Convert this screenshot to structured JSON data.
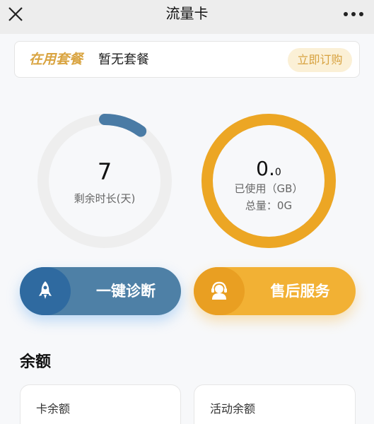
{
  "header": {
    "title": "流量卡",
    "close_icon": "close-icon",
    "more_icon": "more-dots-icon"
  },
  "package": {
    "label": "在用套餐",
    "value": "暂无套餐",
    "subscribe_label": "立即订购"
  },
  "days_ring": {
    "value": "7",
    "label": "剩余时长(天)",
    "progress": 0.1,
    "track_color": "#eeeeee",
    "progress_color": "#4a7ba5"
  },
  "data_ring": {
    "value_main": "0.",
    "value_small": "0",
    "used_label": "已使用（GB）",
    "total_label": "总量：0G",
    "progress": 1.0,
    "track_color": "#ece8e0",
    "progress_color": "#eca624"
  },
  "actions": {
    "diagnose_label": "一键诊断",
    "diagnose_icon": "rocket-icon",
    "service_label": "售后服务",
    "service_icon": "headset-agent-icon"
  },
  "balance": {
    "title": "余额",
    "card_balance_label": "卡余额",
    "promo_balance_label": "活动余额"
  },
  "colors": {
    "accent_gold": "#d9a441",
    "diagnose_blue": "#4e80a6",
    "service_orange": "#f2b134"
  }
}
